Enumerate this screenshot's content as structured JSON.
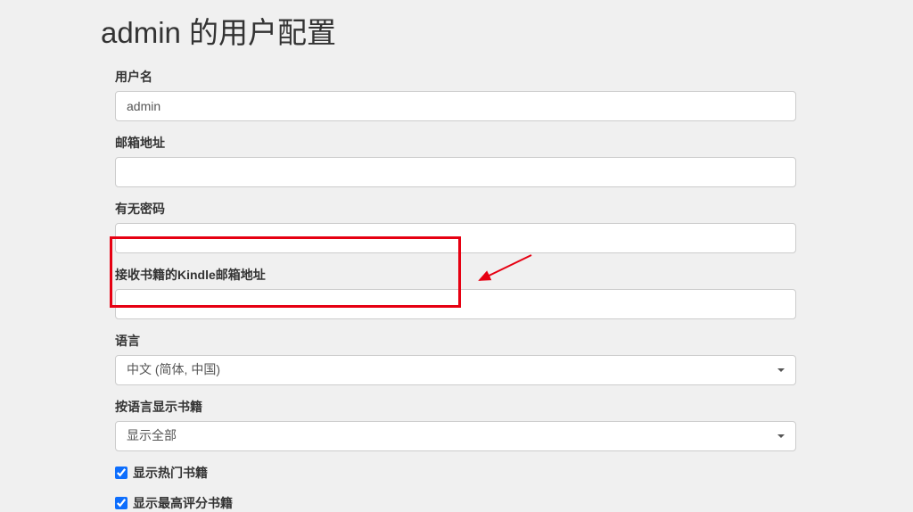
{
  "page": {
    "title": "admin 的用户配置"
  },
  "fields": {
    "username": {
      "label": "用户名",
      "value": "admin"
    },
    "email": {
      "label": "邮箱地址",
      "value": ""
    },
    "password": {
      "label": "有无密码",
      "value": ""
    },
    "kindle_email": {
      "label": "接收书籍的Kindle邮箱地址",
      "value": ""
    },
    "language": {
      "label": "语言",
      "value": "中文 (简体, 中国)"
    },
    "books_language": {
      "label": "按语言显示书籍",
      "value": "显示全部"
    }
  },
  "checkboxes": {
    "show_hot": {
      "label": "显示热门书籍",
      "checked": true
    },
    "show_top_rated": {
      "label": "显示最高评分书籍",
      "checked": true
    }
  }
}
